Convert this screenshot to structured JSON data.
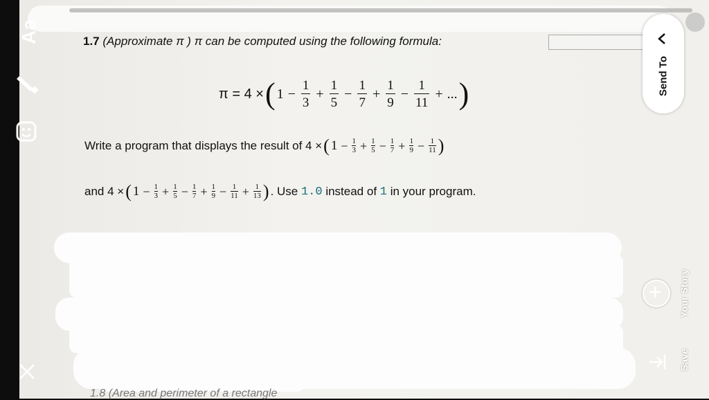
{
  "editor_tools": {
    "text_tool_label": "Aa",
    "pen_icon": "pen-icon",
    "sticker_icon": "sticker-icon",
    "close_icon": "close-icon"
  },
  "document": {
    "heading_number": "1.7",
    "heading_title": "(Approximate π ) π can be computed using the following formula:",
    "formula": {
      "lhs": "π = 4 ×",
      "terms": [
        {
          "op": "",
          "whole": "1"
        },
        {
          "op": "−",
          "num": "1",
          "den": "3"
        },
        {
          "op": "+",
          "num": "1",
          "den": "5"
        },
        {
          "op": "−",
          "num": "1",
          "den": "7"
        },
        {
          "op": "+",
          "num": "1",
          "den": "9"
        },
        {
          "op": "−",
          "num": "1",
          "den": "11"
        },
        {
          "op": "+",
          "whole": "..."
        }
      ]
    },
    "line1_text": "Write a program that displays the result of 4 ×",
    "line2_prefix": "and 4 ×",
    "line2_suffix_1": ". Use ",
    "line2_code_1": "1.0",
    "line2_suffix_2": " instead of ",
    "line2_code_2": "1",
    "line2_suffix_3": " in your program.",
    "bottom_partial": "1.8 (Area and perimeter of a rectangle"
  },
  "send_to": {
    "label": "Send To",
    "chevron_icon": "chevron-right-icon"
  },
  "story": {
    "label": "Your Story",
    "icon": "add-story-icon"
  },
  "save": {
    "label": "Save",
    "icon": "save-download-icon"
  },
  "colors": {
    "code_text": "#1a6f7a",
    "page_bg": "#f1f0ec",
    "ui_text": "#ffffff"
  }
}
